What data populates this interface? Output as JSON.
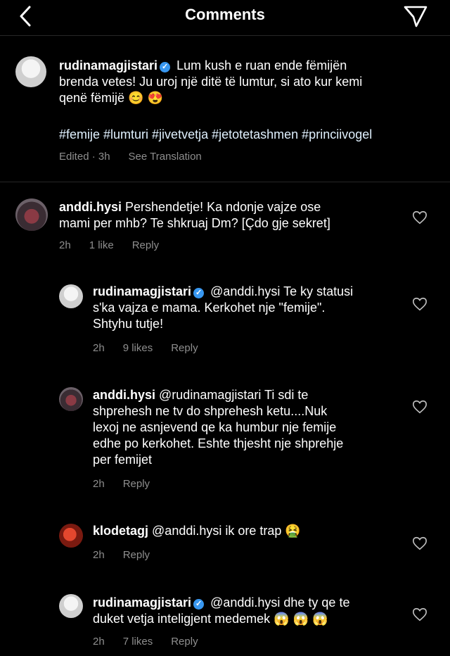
{
  "header": {
    "title": "Comments"
  },
  "caption": {
    "username": "rudinamagjistari",
    "text_line1": "Lum kush e ruan ende fëmijën",
    "text_line2": "brenda vetes! Ju uroj një ditë të lumtur, si ato kur kemi",
    "text_line3": "qenë fëmijë 😊 😍",
    "hashtags": "#femije #lumturi #jivetvetja #jetotetashmen #princiivogel",
    "time": "Edited · 3h",
    "see_translation": "See Translation"
  },
  "comments": [
    {
      "username": "anddi.hysi",
      "line1": "Pershendetje! Ka ndonje vajze ose",
      "line2": "mami per mhb? Te shkruaj Dm? [Çdo gje sekret]",
      "time": "2h",
      "likes": "1 like",
      "reply": "Reply"
    },
    {
      "username": "rudinamagjistari",
      "line1": "@anddi.hysi Te ky statusi",
      "line2": "s'ka vajza e mama. Kerkohet nje \"femije\".",
      "line3": "Shtyhu tutje!",
      "time": "2h",
      "likes": "9 likes",
      "reply": "Reply"
    },
    {
      "username": "anddi.hysi",
      "line1": "@rudinamagjistari Ti sdi te",
      "line2": "shprehesh ne tv do shprehesh ketu....Nuk",
      "line3": "lexoj ne asnjevend qe ka humbur nje femije",
      "line4": "edhe po kerkohet. Eshte thjesht nje shprehje",
      "line5": "per femijet",
      "time": "2h",
      "reply": "Reply"
    },
    {
      "username": "klodetagj",
      "line1": "@anddi.hysi ik ore trap 🤮",
      "time": "2h",
      "reply": "Reply"
    },
    {
      "username": "rudinamagjistari",
      "line1": "@anddi.hysi dhe ty qe te",
      "line2": "duket vetja inteligjent medemek 😱 😱 😱",
      "time": "2h",
      "likes": "7 likes",
      "reply": "Reply"
    }
  ],
  "icons": {
    "back": "chevron-left-icon",
    "send": "paper-plane-icon",
    "like": "heart-outline-icon",
    "verified": "verified-badge-icon"
  },
  "colors": {
    "background": "#000000",
    "meta": "#8e8e8e",
    "verified": "#3897f0"
  }
}
